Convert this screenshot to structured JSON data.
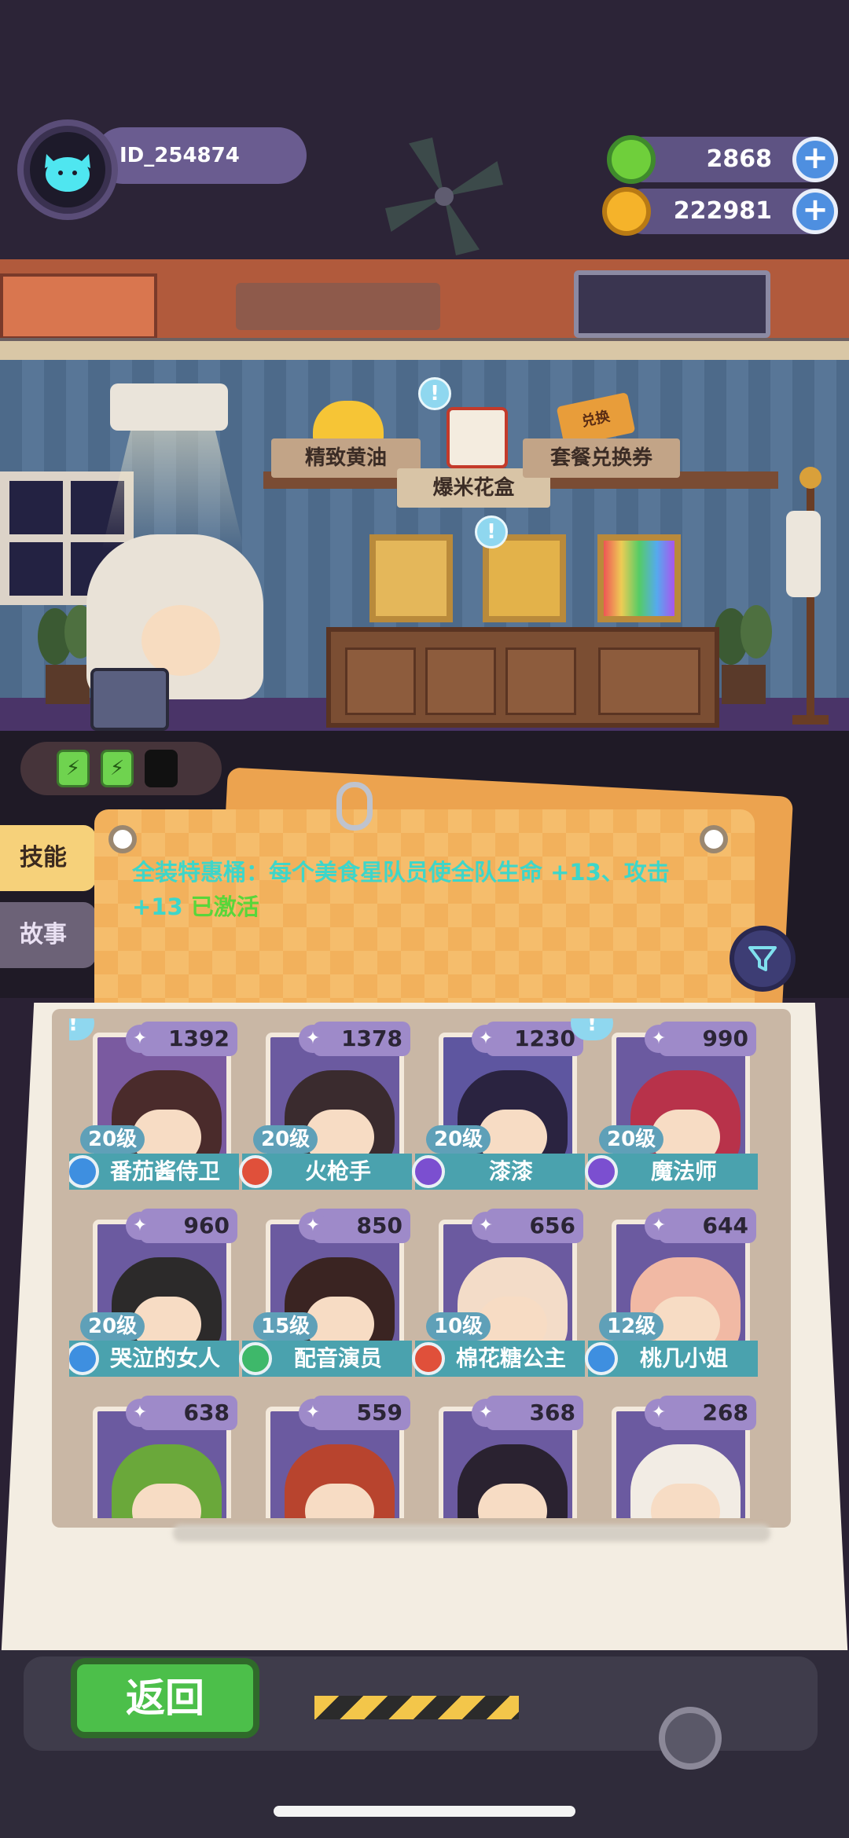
{
  "header": {
    "player_id": "ID_254874",
    "currencies": [
      {
        "name": "green-donut",
        "value": "2868",
        "color": "#6fcf3b"
      },
      {
        "name": "gold-planet",
        "value": "222981",
        "color": "#f5b32a"
      }
    ]
  },
  "shop": {
    "menu_items": [
      "精致黄油",
      "爆米花盒",
      "套餐兑换券"
    ],
    "ticket_label": "兑换"
  },
  "tabs": {
    "skill": "技能",
    "story": "故事"
  },
  "skill_board": {
    "description": "全装特惠桶：每个美食星队员使全队生命 +13、攻击 +13",
    "status": "已激活"
  },
  "roster": [
    {
      "power": "1392",
      "level": "20级",
      "name": "番茄酱侍卫",
      "role_color": "#3e8fe0",
      "hair": "#4a2b2b",
      "bg": "#7a5aa0",
      "hint": true
    },
    {
      "power": "1378",
      "level": "20级",
      "name": "火枪手",
      "role_color": "#e0503a",
      "hair": "#3a2b2e",
      "bg": "#6b5aa0",
      "hint": false
    },
    {
      "power": "1230",
      "level": "20级",
      "name": "漆漆",
      "role_color": "#7b4fd0",
      "hair": "#2a2340",
      "bg": "#5e56a0",
      "hint": false
    },
    {
      "power": "990",
      "level": "20级",
      "name": "魔法师",
      "role_color": "#7b4fd0",
      "hair": "#b8324a",
      "bg": "#6b5aa0",
      "hint": true
    },
    {
      "power": "960",
      "level": "20级",
      "name": "哭泣的女人",
      "role_color": "#3e8fe0",
      "hair": "#2c2a2a",
      "bg": "#6b5aa0",
      "hint": false
    },
    {
      "power": "850",
      "level": "15级",
      "name": "配音演员",
      "role_color": "#3eb86a",
      "hair": "#3a2422",
      "bg": "#6b5aa0",
      "hint": false
    },
    {
      "power": "656",
      "level": "10级",
      "name": "棉花糖公主",
      "role_color": "#e0503a",
      "hair": "#f3dcc8",
      "bg": "#6b5aa0",
      "hint": false
    },
    {
      "power": "644",
      "level": "12级",
      "name": "桃几小姐",
      "role_color": "#3e8fe0",
      "hair": "#f1b9a4",
      "bg": "#6b5aa0",
      "hint": false
    },
    {
      "power": "638",
      "level": "",
      "name": "",
      "role_color": "#3e8fe0",
      "hair": "#6aa83a",
      "bg": "#6b5aa0",
      "hint": false
    },
    {
      "power": "559",
      "level": "",
      "name": "",
      "role_color": "#3e8fe0",
      "hair": "#b8442e",
      "bg": "#6b5aa0",
      "hint": false
    },
    {
      "power": "368",
      "level": "",
      "name": "",
      "role_color": "#3e8fe0",
      "hair": "#2a2230",
      "bg": "#6b5aa0",
      "hint": false
    },
    {
      "power": "268",
      "level": "",
      "name": "",
      "role_color": "#3e8fe0",
      "hair": "#f2ece4",
      "bg": "#6b5aa0",
      "hint": false
    }
  ],
  "footer": {
    "back_label": "返回"
  },
  "colors": {
    "accent_teal": "#3ed6c9",
    "active_green": "#59d63a",
    "tab_active": "#f6d17a"
  }
}
